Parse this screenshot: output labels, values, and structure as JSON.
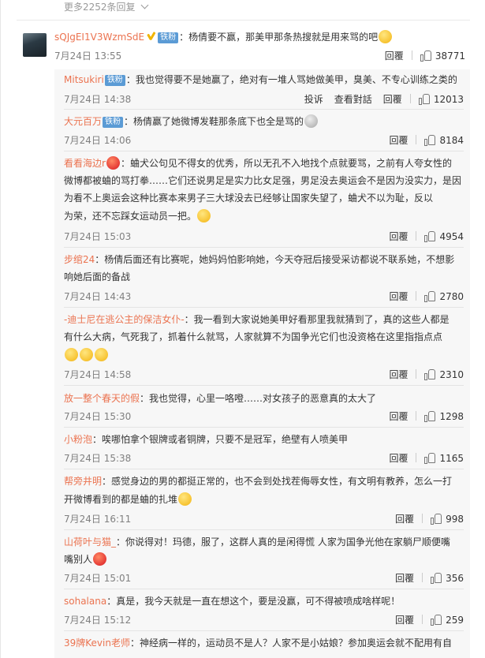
{
  "more_replies": "更多2252条回复",
  "main_comment": {
    "user": "sQJgEI1V3WzmSdE",
    "badge": "铁粉",
    "text": "：杨倩要不赢，那美甲那条热搜就是用来骂的吧",
    "time": "7月24日 13:55",
    "reply": "回覆",
    "likes": "38771"
  },
  "replies": [
    {
      "user": "Mitsukiri",
      "badge": "铁粉",
      "text1": "：我也觉得要不是她赢了，绝对有一堆人骂她做美甲，臭美、不专心训练之类的",
      "text2": "",
      "text3": "",
      "time": "7月24日 14:38",
      "extra": [
        "投诉",
        "查看對話"
      ],
      "reply": "回覆",
      "likes": "12013"
    },
    {
      "user": "大元百万",
      "badge": "铁粉",
      "text1": "：杨倩赢了她微博发鞋那条底下也全是骂的",
      "text2": "",
      "text3": "",
      "time": "7月24日 14:06",
      "extra": [],
      "reply": "回覆",
      "likes": "8184"
    },
    {
      "user": "看看海边r",
      "badge": "",
      "text1": "：蛐犬公句见不得女的优秀，所以无孔不入地找个点就要骂，之前有人夸女性的",
      "text2": "微博都被蛐的骂打拳……它们还说男足是实力比女足强，男足没去奥运会不是因为没实力，是因",
      "text3": "为看不上奥运会这种比赛本来男子三大球没去已经够让国家失望了，蛐犬不以为耻，反以",
      "text4": "为荣，还不忘踩女运动员一把。",
      "time": "7月24日 15:03",
      "extra": [],
      "reply": "回覆",
      "likes": "4954"
    },
    {
      "user": "步绾24",
      "badge": "",
      "text1": "：杨倩后面还有比赛呢，她妈妈怕影响她，今天夺冠后接受采访都说不联系她，不想影",
      "text2": "响她后面的备战",
      "text3": "",
      "time": "7月24日 14:43",
      "extra": [],
      "reply": "回覆",
      "likes": "2780"
    },
    {
      "user": "-迪士尼在逃公主的保洁女仆-",
      "badge": "",
      "text1": "：我一看到大家说她美甲好看那里我就猜到了，真的这些人都是",
      "text2": "有什么大病，气死我了，抓着什么就骂，人家就算不为国争光它们也没资格在这里指指点点",
      "text3": "",
      "time": "7月24日 14:58",
      "extra": [],
      "reply": "回覆",
      "likes": "2310"
    },
    {
      "user": "放一整个春天的假",
      "badge": "",
      "text1": "：我也觉得，心里一咯噔……对女孩子的恶意真的太大了",
      "text2": "",
      "text3": "",
      "time": "7月24日 15:30",
      "extra": [],
      "reply": "回覆",
      "likes": "1298"
    },
    {
      "user": "小粉泡",
      "badge": "",
      "text1": "：唉哪怕拿个银牌或者铜牌，只要不是冠军，绝壁有人喷美甲",
      "text2": "",
      "text3": "",
      "time": "7月24日 15:38",
      "extra": [],
      "reply": "回覆",
      "likes": "1165"
    },
    {
      "user": "帮旁井明",
      "badge": "",
      "text1": "：感觉身边的男的都挺正常的，也不会到处找茬侮辱女性，有文明有教养，怎么一打",
      "text2": "开微博看到的都是蛐的扎堆",
      "text3": "",
      "time": "7月24日 16:11",
      "extra": [],
      "reply": "回覆",
      "likes": "998"
    },
    {
      "user": "山荷叶与猫_",
      "badge": "",
      "text1": "：你说得对！玛德，服了，这群人真的是闲得慌  人家为国争光他在家躺尸顺便嘴",
      "text2": "嘴别人",
      "text3": "",
      "time": "7月24日 15:01",
      "extra": [],
      "reply": "回覆",
      "likes": "356"
    },
    {
      "user": "sohalana",
      "badge": "",
      "text1": "：真是，我今天就是一直在想这个，要是没赢，可不得被喷成啥样呢！",
      "text2": "",
      "text3": "",
      "time": "7月24日 15:12",
      "extra": [],
      "reply": "回覆",
      "likes": "259"
    },
    {
      "user": "39牌Kevin老师",
      "badge": "",
      "text1": "：神经病一样的，运动员不是人？人家不是小姑娘？参加奥运会就不配用有自",
      "text2": "",
      "text3": "",
      "time": "",
      "extra": [],
      "reply": "",
      "likes": ""
    }
  ]
}
